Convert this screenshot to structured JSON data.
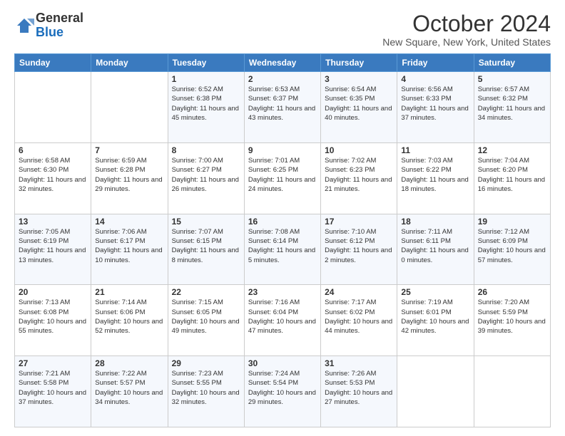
{
  "logo": {
    "general": "General",
    "blue": "Blue"
  },
  "title": "October 2024",
  "subtitle": "New Square, New York, United States",
  "days_of_week": [
    "Sunday",
    "Monday",
    "Tuesday",
    "Wednesday",
    "Thursday",
    "Friday",
    "Saturday"
  ],
  "weeks": [
    [
      {
        "day": "",
        "sunrise": "",
        "sunset": "",
        "daylight": ""
      },
      {
        "day": "",
        "sunrise": "",
        "sunset": "",
        "daylight": ""
      },
      {
        "day": "1",
        "sunrise": "Sunrise: 6:52 AM",
        "sunset": "Sunset: 6:38 PM",
        "daylight": "Daylight: 11 hours and 45 minutes."
      },
      {
        "day": "2",
        "sunrise": "Sunrise: 6:53 AM",
        "sunset": "Sunset: 6:37 PM",
        "daylight": "Daylight: 11 hours and 43 minutes."
      },
      {
        "day": "3",
        "sunrise": "Sunrise: 6:54 AM",
        "sunset": "Sunset: 6:35 PM",
        "daylight": "Daylight: 11 hours and 40 minutes."
      },
      {
        "day": "4",
        "sunrise": "Sunrise: 6:56 AM",
        "sunset": "Sunset: 6:33 PM",
        "daylight": "Daylight: 11 hours and 37 minutes."
      },
      {
        "day": "5",
        "sunrise": "Sunrise: 6:57 AM",
        "sunset": "Sunset: 6:32 PM",
        "daylight": "Daylight: 11 hours and 34 minutes."
      }
    ],
    [
      {
        "day": "6",
        "sunrise": "Sunrise: 6:58 AM",
        "sunset": "Sunset: 6:30 PM",
        "daylight": "Daylight: 11 hours and 32 minutes."
      },
      {
        "day": "7",
        "sunrise": "Sunrise: 6:59 AM",
        "sunset": "Sunset: 6:28 PM",
        "daylight": "Daylight: 11 hours and 29 minutes."
      },
      {
        "day": "8",
        "sunrise": "Sunrise: 7:00 AM",
        "sunset": "Sunset: 6:27 PM",
        "daylight": "Daylight: 11 hours and 26 minutes."
      },
      {
        "day": "9",
        "sunrise": "Sunrise: 7:01 AM",
        "sunset": "Sunset: 6:25 PM",
        "daylight": "Daylight: 11 hours and 24 minutes."
      },
      {
        "day": "10",
        "sunrise": "Sunrise: 7:02 AM",
        "sunset": "Sunset: 6:23 PM",
        "daylight": "Daylight: 11 hours and 21 minutes."
      },
      {
        "day": "11",
        "sunrise": "Sunrise: 7:03 AM",
        "sunset": "Sunset: 6:22 PM",
        "daylight": "Daylight: 11 hours and 18 minutes."
      },
      {
        "day": "12",
        "sunrise": "Sunrise: 7:04 AM",
        "sunset": "Sunset: 6:20 PM",
        "daylight": "Daylight: 11 hours and 16 minutes."
      }
    ],
    [
      {
        "day": "13",
        "sunrise": "Sunrise: 7:05 AM",
        "sunset": "Sunset: 6:19 PM",
        "daylight": "Daylight: 11 hours and 13 minutes."
      },
      {
        "day": "14",
        "sunrise": "Sunrise: 7:06 AM",
        "sunset": "Sunset: 6:17 PM",
        "daylight": "Daylight: 11 hours and 10 minutes."
      },
      {
        "day": "15",
        "sunrise": "Sunrise: 7:07 AM",
        "sunset": "Sunset: 6:15 PM",
        "daylight": "Daylight: 11 hours and 8 minutes."
      },
      {
        "day": "16",
        "sunrise": "Sunrise: 7:08 AM",
        "sunset": "Sunset: 6:14 PM",
        "daylight": "Daylight: 11 hours and 5 minutes."
      },
      {
        "day": "17",
        "sunrise": "Sunrise: 7:10 AM",
        "sunset": "Sunset: 6:12 PM",
        "daylight": "Daylight: 11 hours and 2 minutes."
      },
      {
        "day": "18",
        "sunrise": "Sunrise: 7:11 AM",
        "sunset": "Sunset: 6:11 PM",
        "daylight": "Daylight: 11 hours and 0 minutes."
      },
      {
        "day": "19",
        "sunrise": "Sunrise: 7:12 AM",
        "sunset": "Sunset: 6:09 PM",
        "daylight": "Daylight: 10 hours and 57 minutes."
      }
    ],
    [
      {
        "day": "20",
        "sunrise": "Sunrise: 7:13 AM",
        "sunset": "Sunset: 6:08 PM",
        "daylight": "Daylight: 10 hours and 55 minutes."
      },
      {
        "day": "21",
        "sunrise": "Sunrise: 7:14 AM",
        "sunset": "Sunset: 6:06 PM",
        "daylight": "Daylight: 10 hours and 52 minutes."
      },
      {
        "day": "22",
        "sunrise": "Sunrise: 7:15 AM",
        "sunset": "Sunset: 6:05 PM",
        "daylight": "Daylight: 10 hours and 49 minutes."
      },
      {
        "day": "23",
        "sunrise": "Sunrise: 7:16 AM",
        "sunset": "Sunset: 6:04 PM",
        "daylight": "Daylight: 10 hours and 47 minutes."
      },
      {
        "day": "24",
        "sunrise": "Sunrise: 7:17 AM",
        "sunset": "Sunset: 6:02 PM",
        "daylight": "Daylight: 10 hours and 44 minutes."
      },
      {
        "day": "25",
        "sunrise": "Sunrise: 7:19 AM",
        "sunset": "Sunset: 6:01 PM",
        "daylight": "Daylight: 10 hours and 42 minutes."
      },
      {
        "day": "26",
        "sunrise": "Sunrise: 7:20 AM",
        "sunset": "Sunset: 5:59 PM",
        "daylight": "Daylight: 10 hours and 39 minutes."
      }
    ],
    [
      {
        "day": "27",
        "sunrise": "Sunrise: 7:21 AM",
        "sunset": "Sunset: 5:58 PM",
        "daylight": "Daylight: 10 hours and 37 minutes."
      },
      {
        "day": "28",
        "sunrise": "Sunrise: 7:22 AM",
        "sunset": "Sunset: 5:57 PM",
        "daylight": "Daylight: 10 hours and 34 minutes."
      },
      {
        "day": "29",
        "sunrise": "Sunrise: 7:23 AM",
        "sunset": "Sunset: 5:55 PM",
        "daylight": "Daylight: 10 hours and 32 minutes."
      },
      {
        "day": "30",
        "sunrise": "Sunrise: 7:24 AM",
        "sunset": "Sunset: 5:54 PM",
        "daylight": "Daylight: 10 hours and 29 minutes."
      },
      {
        "day": "31",
        "sunrise": "Sunrise: 7:26 AM",
        "sunset": "Sunset: 5:53 PM",
        "daylight": "Daylight: 10 hours and 27 minutes."
      },
      {
        "day": "",
        "sunrise": "",
        "sunset": "",
        "daylight": ""
      },
      {
        "day": "",
        "sunrise": "",
        "sunset": "",
        "daylight": ""
      }
    ]
  ]
}
